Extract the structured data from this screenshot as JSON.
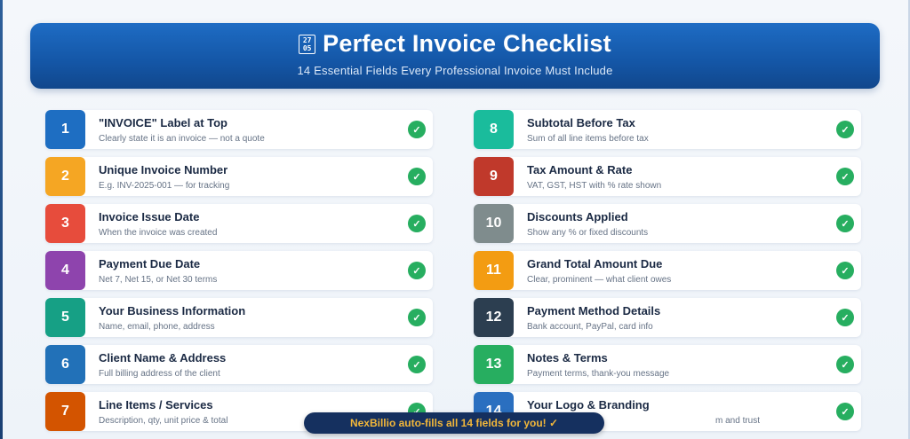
{
  "header": {
    "icon_text": "2705",
    "icon_line1": "27",
    "icon_line2": "05",
    "title": "Perfect Invoice Checklist",
    "subtitle": "14 Essential Fields Every Professional Invoice Must Include"
  },
  "check_glyph": "✓",
  "items_left": [
    {
      "num": "1",
      "title": "\"INVOICE\" Label at Top",
      "desc": "Clearly state it is an invoice — not a quote",
      "color": "#1e6ec2"
    },
    {
      "num": "2",
      "title": "Unique Invoice Number",
      "desc": "E.g. INV-2025-001 — for tracking",
      "color": "#f5a623"
    },
    {
      "num": "3",
      "title": "Invoice Issue Date",
      "desc": "When the invoice was created",
      "color": "#e74c3c"
    },
    {
      "num": "4",
      "title": "Payment Due Date",
      "desc": "Net 7, Net 15, or Net 30 terms",
      "color": "#8e44ad"
    },
    {
      "num": "5",
      "title": "Your Business Information",
      "desc": "Name, email, phone, address",
      "color": "#16a085"
    },
    {
      "num": "6",
      "title": "Client Name & Address",
      "desc": "Full billing address of the client",
      "color": "#2271b8"
    },
    {
      "num": "7",
      "title": "Line Items / Services",
      "desc": "Description, qty, unit price & total",
      "color": "#d35400"
    }
  ],
  "items_right": [
    {
      "num": "8",
      "title": "Subtotal Before Tax",
      "desc": "Sum of all line items before tax",
      "color": "#1abc9c"
    },
    {
      "num": "9",
      "title": "Tax Amount & Rate",
      "desc": "VAT, GST, HST with % rate shown",
      "color": "#c0392b"
    },
    {
      "num": "10",
      "title": "Discounts Applied",
      "desc": "Show any % or fixed discounts",
      "color": "#7f8c8d"
    },
    {
      "num": "11",
      "title": "Grand Total Amount Due",
      "desc": "Clear, prominent — what client owes",
      "color": "#f39c12"
    },
    {
      "num": "12",
      "title": "Payment Method Details",
      "desc": "Bank account, PayPal, card info",
      "color": "#2c3e50"
    },
    {
      "num": "13",
      "title": "Notes & Terms",
      "desc": "Payment terms, thank-you message",
      "color": "#27ae60"
    },
    {
      "num": "14",
      "title": "Your Logo & Branding",
      "desc": "m and trust",
      "color": "#2a6fc0"
    }
  ],
  "banner": {
    "text": "NexBillio auto-fills all 14 fields for you! ✓"
  }
}
